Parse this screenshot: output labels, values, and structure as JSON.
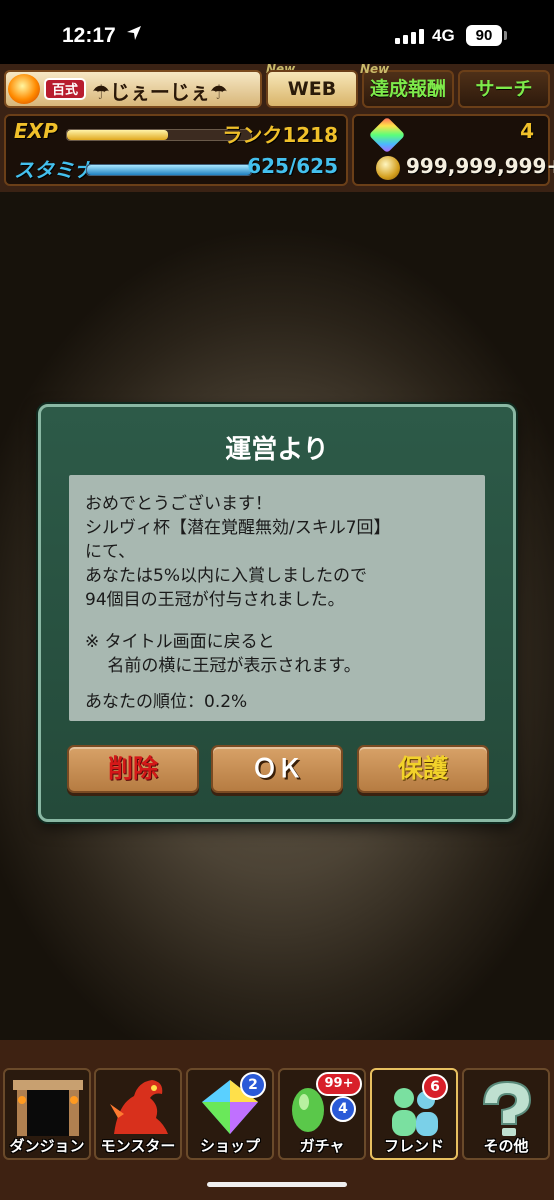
{
  "status_bar": {
    "time": "12:17",
    "network": "4G",
    "battery": "90"
  },
  "header": {
    "rank_badge": "百式",
    "player_name": "☂じぇーじぇ☂",
    "new_tag": "New",
    "web_button": "WEB",
    "achievement_button": "達成報酬",
    "search_button": "サーチ",
    "exp_label": "EXP",
    "exp_progress": 0.55,
    "rank": "ランク1218",
    "stamina_label": "スタミナ",
    "stamina_progress": 1.0,
    "stamina": "625/625",
    "stones": "4",
    "coins": "999,999,999+"
  },
  "dialog": {
    "title": "運営より",
    "lines": [
      "おめでとうございます！",
      "シルヴィ杯【潜在覚醒無効/スキル7回】",
      "にて、",
      "あなたは5%以内に入賞しましたので",
      "94個目の王冠が付与されました。",
      "",
      "※ タイトル画面に戻ると",
      "　 名前の横に王冠が表示されます。",
      "",
      "あなたの順位：0.2%"
    ],
    "delete_button": "削除",
    "ok_button": "ＯＫ",
    "protect_button": "保護"
  },
  "nav": {
    "items": [
      {
        "label": "ダンジョン"
      },
      {
        "label": "モンスター"
      },
      {
        "label": "ショップ",
        "badge": "2"
      },
      {
        "label": "ガチャ",
        "badge_top": "99+",
        "badge_bottom": "4"
      },
      {
        "label": "フレンド",
        "badge": "6"
      },
      {
        "label": "その他"
      }
    ]
  },
  "colors": {
    "dialog_bg": "#2d5a48",
    "message_bg": "#a8b8b1",
    "button_bg": "#c98f55",
    "delete_text": "#d41818",
    "protect_text": "#f2d22a",
    "exp_color": "#f0c02a",
    "stamina_color": "#44c0ee"
  }
}
